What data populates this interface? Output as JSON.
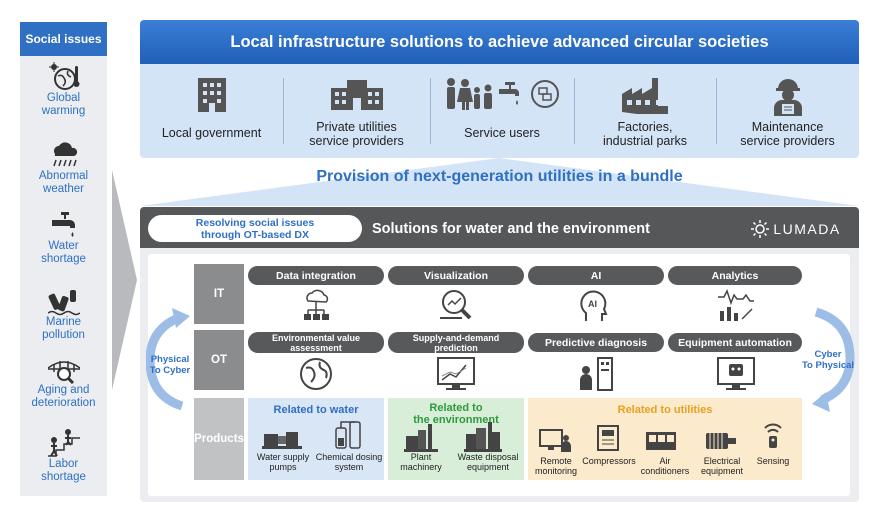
{
  "social_issues": {
    "title": "Social issues",
    "items": [
      {
        "label": "Global\nwarming",
        "icon": "earth-thermometer-icon"
      },
      {
        "label": "Abnormal\nweather",
        "icon": "rain-cloud-icon"
      },
      {
        "label": "Water\nshortage",
        "icon": "faucet-icon"
      },
      {
        "label": "Marine\npollution",
        "icon": "bottles-icon"
      },
      {
        "label": "Aging and\ndeterioration",
        "icon": "bridge-magnifier-icon"
      },
      {
        "label": "Labor\nshortage",
        "icon": "workers-stairs-icon"
      }
    ]
  },
  "header": {
    "title": "Local infrastructure solutions to achieve advanced circular societies"
  },
  "stakeholders": [
    {
      "label": "Local government",
      "icon": "building-icon"
    },
    {
      "label": "Private utilities\nservice providers",
      "icon": "office-building-icon"
    },
    {
      "label": "Service users",
      "icon": "family-faucet-icon"
    },
    {
      "label": "Factories,\nindustrial parks",
      "icon": "factory-icon"
    },
    {
      "label": "Maintenance\nservice providers",
      "icon": "worker-helmet-icon"
    }
  ],
  "provision": "Provision of next-generation utilities in a bundle",
  "solutions": {
    "pill": "Resolving social issues\nthrough OT-based DX",
    "title": "Solutions for water and the environment",
    "brand": "LUMADA"
  },
  "rows": {
    "it": "IT",
    "ot": "OT",
    "products": "Products"
  },
  "it_items": [
    {
      "label": "Data integration",
      "icon": "cloud-network-icon"
    },
    {
      "label": "Visualization",
      "icon": "magnifier-chart-icon"
    },
    {
      "label": "AI",
      "icon": "ai-head-icon"
    },
    {
      "label": "Analytics",
      "icon": "analytics-chart-icon"
    }
  ],
  "ot_items": [
    {
      "label": "Environmental value\nassessment",
      "icon": "globe-icon"
    },
    {
      "label": "Supply-and-demand\nprediction",
      "icon": "monitor-chart-icon"
    },
    {
      "label": "Predictive diagnosis",
      "icon": "worker-panel-icon"
    },
    {
      "label": "Equipment automation",
      "icon": "robot-monitor-icon"
    }
  ],
  "side_labels": {
    "left": "Physical\nTo Cyber",
    "right": "Cyber\nTo Physical"
  },
  "products": {
    "water": {
      "title": "Related to water",
      "items": [
        {
          "label": "Water supply\npumps",
          "icon": "pump-icon"
        },
        {
          "label": "Chemical dosing\nsystem",
          "icon": "dosing-icon"
        }
      ]
    },
    "environment": {
      "title": "Related to\nthe environment",
      "items": [
        {
          "label": "Plant\nmachinery",
          "icon": "plant-icon"
        },
        {
          "label": "Waste disposal\nequipment",
          "icon": "waste-plant-icon"
        }
      ]
    },
    "utilities": {
      "title": "Related to utilities",
      "items": [
        {
          "label": "Remote\nmonitoring",
          "icon": "remote-monitor-icon"
        },
        {
          "label": "Compressors",
          "icon": "compressor-icon"
        },
        {
          "label": "Air\nconditioners",
          "icon": "air-conditioner-icon"
        },
        {
          "label": "Electrical\nequipment",
          "icon": "motor-icon"
        },
        {
          "label": "Sensing",
          "icon": "sensor-icon"
        }
      ]
    }
  },
  "colors": {
    "blue": "#2f6fc4",
    "water_bg": "#d8e6f6",
    "env_bg": "#d8eed8",
    "util_bg": "#fbeacc",
    "env_text": "#2e9a3c",
    "util_text": "#e8a020"
  }
}
